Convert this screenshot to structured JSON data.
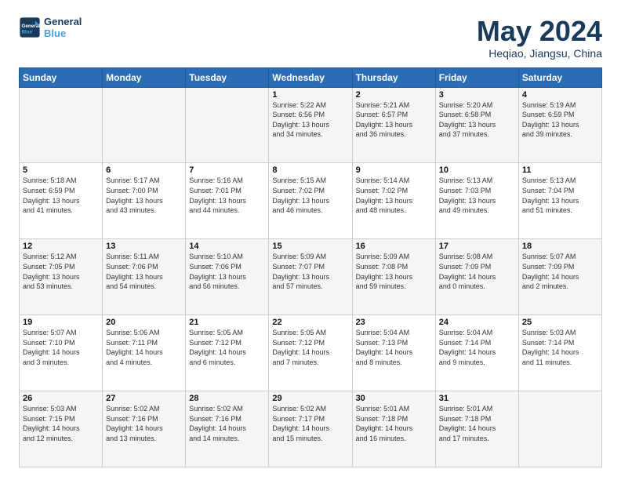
{
  "header": {
    "logo_line1": "General",
    "logo_line2": "Blue",
    "title": "May 2024",
    "subtitle": "Heqiao, Jiangsu, China"
  },
  "weekdays": [
    "Sunday",
    "Monday",
    "Tuesday",
    "Wednesday",
    "Thursday",
    "Friday",
    "Saturday"
  ],
  "weeks": [
    [
      {
        "day": "",
        "info": ""
      },
      {
        "day": "",
        "info": ""
      },
      {
        "day": "",
        "info": ""
      },
      {
        "day": "1",
        "info": "Sunrise: 5:22 AM\nSunset: 6:56 PM\nDaylight: 13 hours\nand 34 minutes."
      },
      {
        "day": "2",
        "info": "Sunrise: 5:21 AM\nSunset: 6:57 PM\nDaylight: 13 hours\nand 36 minutes."
      },
      {
        "day": "3",
        "info": "Sunrise: 5:20 AM\nSunset: 6:58 PM\nDaylight: 13 hours\nand 37 minutes."
      },
      {
        "day": "4",
        "info": "Sunrise: 5:19 AM\nSunset: 6:59 PM\nDaylight: 13 hours\nand 39 minutes."
      }
    ],
    [
      {
        "day": "5",
        "info": "Sunrise: 5:18 AM\nSunset: 6:59 PM\nDaylight: 13 hours\nand 41 minutes."
      },
      {
        "day": "6",
        "info": "Sunrise: 5:17 AM\nSunset: 7:00 PM\nDaylight: 13 hours\nand 43 minutes."
      },
      {
        "day": "7",
        "info": "Sunrise: 5:16 AM\nSunset: 7:01 PM\nDaylight: 13 hours\nand 44 minutes."
      },
      {
        "day": "8",
        "info": "Sunrise: 5:15 AM\nSunset: 7:02 PM\nDaylight: 13 hours\nand 46 minutes."
      },
      {
        "day": "9",
        "info": "Sunrise: 5:14 AM\nSunset: 7:02 PM\nDaylight: 13 hours\nand 48 minutes."
      },
      {
        "day": "10",
        "info": "Sunrise: 5:13 AM\nSunset: 7:03 PM\nDaylight: 13 hours\nand 49 minutes."
      },
      {
        "day": "11",
        "info": "Sunrise: 5:13 AM\nSunset: 7:04 PM\nDaylight: 13 hours\nand 51 minutes."
      }
    ],
    [
      {
        "day": "12",
        "info": "Sunrise: 5:12 AM\nSunset: 7:05 PM\nDaylight: 13 hours\nand 53 minutes."
      },
      {
        "day": "13",
        "info": "Sunrise: 5:11 AM\nSunset: 7:06 PM\nDaylight: 13 hours\nand 54 minutes."
      },
      {
        "day": "14",
        "info": "Sunrise: 5:10 AM\nSunset: 7:06 PM\nDaylight: 13 hours\nand 56 minutes."
      },
      {
        "day": "15",
        "info": "Sunrise: 5:09 AM\nSunset: 7:07 PM\nDaylight: 13 hours\nand 57 minutes."
      },
      {
        "day": "16",
        "info": "Sunrise: 5:09 AM\nSunset: 7:08 PM\nDaylight: 13 hours\nand 59 minutes."
      },
      {
        "day": "17",
        "info": "Sunrise: 5:08 AM\nSunset: 7:09 PM\nDaylight: 14 hours\nand 0 minutes."
      },
      {
        "day": "18",
        "info": "Sunrise: 5:07 AM\nSunset: 7:09 PM\nDaylight: 14 hours\nand 2 minutes."
      }
    ],
    [
      {
        "day": "19",
        "info": "Sunrise: 5:07 AM\nSunset: 7:10 PM\nDaylight: 14 hours\nand 3 minutes."
      },
      {
        "day": "20",
        "info": "Sunrise: 5:06 AM\nSunset: 7:11 PM\nDaylight: 14 hours\nand 4 minutes."
      },
      {
        "day": "21",
        "info": "Sunrise: 5:05 AM\nSunset: 7:12 PM\nDaylight: 14 hours\nand 6 minutes."
      },
      {
        "day": "22",
        "info": "Sunrise: 5:05 AM\nSunset: 7:12 PM\nDaylight: 14 hours\nand 7 minutes."
      },
      {
        "day": "23",
        "info": "Sunrise: 5:04 AM\nSunset: 7:13 PM\nDaylight: 14 hours\nand 8 minutes."
      },
      {
        "day": "24",
        "info": "Sunrise: 5:04 AM\nSunset: 7:14 PM\nDaylight: 14 hours\nand 9 minutes."
      },
      {
        "day": "25",
        "info": "Sunrise: 5:03 AM\nSunset: 7:14 PM\nDaylight: 14 hours\nand 11 minutes."
      }
    ],
    [
      {
        "day": "26",
        "info": "Sunrise: 5:03 AM\nSunset: 7:15 PM\nDaylight: 14 hours\nand 12 minutes."
      },
      {
        "day": "27",
        "info": "Sunrise: 5:02 AM\nSunset: 7:16 PM\nDaylight: 14 hours\nand 13 minutes."
      },
      {
        "day": "28",
        "info": "Sunrise: 5:02 AM\nSunset: 7:16 PM\nDaylight: 14 hours\nand 14 minutes."
      },
      {
        "day": "29",
        "info": "Sunrise: 5:02 AM\nSunset: 7:17 PM\nDaylight: 14 hours\nand 15 minutes."
      },
      {
        "day": "30",
        "info": "Sunrise: 5:01 AM\nSunset: 7:18 PM\nDaylight: 14 hours\nand 16 minutes."
      },
      {
        "day": "31",
        "info": "Sunrise: 5:01 AM\nSunset: 7:18 PM\nDaylight: 14 hours\nand 17 minutes."
      },
      {
        "day": "",
        "info": ""
      }
    ]
  ]
}
